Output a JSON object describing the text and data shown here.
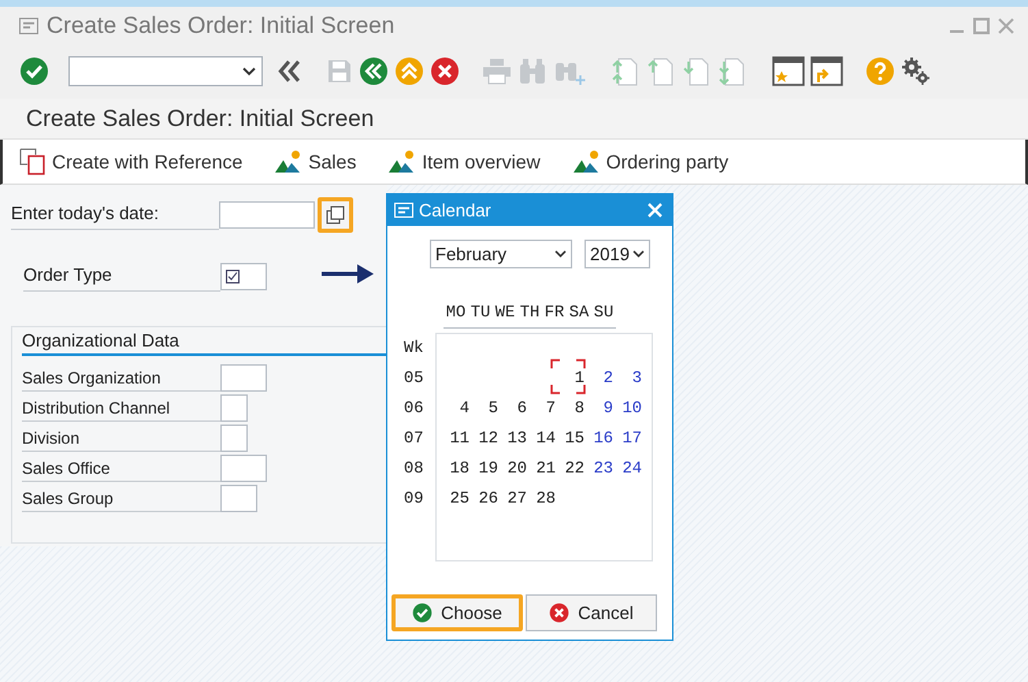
{
  "window": {
    "title": "Create Sales Order: Initial Screen"
  },
  "toolbar": [
    {
      "kind": "enter",
      "disabled": false
    },
    {
      "kind": "command_field",
      "disabled": false
    },
    {
      "kind": "back_arrows",
      "disabled": false
    },
    {
      "kind": "save",
      "disabled": true
    },
    {
      "kind": "back",
      "disabled": false
    },
    {
      "kind": "exit",
      "disabled": false
    },
    {
      "kind": "cancel",
      "disabled": false
    },
    {
      "kind": "print",
      "disabled": true
    },
    {
      "kind": "find",
      "disabled": true
    },
    {
      "kind": "find_next",
      "disabled": true
    },
    {
      "kind": "first_page",
      "disabled": true
    },
    {
      "kind": "prev_page",
      "disabled": true
    },
    {
      "kind": "next_page",
      "disabled": true
    },
    {
      "kind": "last_page",
      "disabled": true
    },
    {
      "kind": "new_session",
      "disabled": false
    },
    {
      "kind": "shortcut",
      "disabled": false
    },
    {
      "kind": "help",
      "disabled": false
    },
    {
      "kind": "settings",
      "disabled": false
    }
  ],
  "screen_title": "Create Sales Order: Initial Screen",
  "actions": [
    {
      "kind": "reference",
      "label": "Create with Reference"
    },
    {
      "kind": "overview",
      "label": "Sales"
    },
    {
      "kind": "overview",
      "label": "Item overview"
    },
    {
      "kind": "overview",
      "label": "Ordering party"
    }
  ],
  "date_field": {
    "label": "Enter today's date:",
    "button_highlighted": true
  },
  "order_type": {
    "label": "Order Type"
  },
  "org_data": {
    "title": "Organizational Data",
    "fields": [
      {
        "label": "Sales Organization"
      },
      {
        "label": "Distribution Channel"
      },
      {
        "label": "Division"
      },
      {
        "label": "Sales Office"
      },
      {
        "label": "Sales Group"
      }
    ]
  },
  "calendar": {
    "title": "Calendar",
    "month": "February",
    "year": "2019",
    "weekdays": [
      "MO",
      "TU",
      "WE",
      "TH",
      "FR",
      "SA",
      "SU"
    ],
    "week_header": "Wk",
    "weeks": [
      {
        "week": "05",
        "kind": "partial_start",
        "days": [
          {
            "label": "1",
            "weekend": false,
            "selected": true
          },
          {
            "label": "2",
            "weekend": true,
            "selected": false
          },
          {
            "label": "3",
            "weekend": true,
            "selected": false
          }
        ]
      },
      {
        "week": "06",
        "kind": "full",
        "days": [
          {
            "label": "4",
            "weekend": false,
            "selected": false
          },
          {
            "label": "5",
            "weekend": false,
            "selected": false
          },
          {
            "label": "6",
            "weekend": false,
            "selected": false
          },
          {
            "label": "7",
            "weekend": false,
            "selected": false
          },
          {
            "label": "8",
            "weekend": false,
            "selected": false
          },
          {
            "label": "9",
            "weekend": true,
            "selected": false
          },
          {
            "label": "10",
            "weekend": true,
            "selected": false
          }
        ]
      },
      {
        "week": "07",
        "kind": "full",
        "days": [
          {
            "label": "11",
            "weekend": false,
            "selected": false
          },
          {
            "label": "12",
            "weekend": false,
            "selected": false
          },
          {
            "label": "13",
            "weekend": false,
            "selected": false
          },
          {
            "label": "14",
            "weekend": false,
            "selected": false
          },
          {
            "label": "15",
            "weekend": false,
            "selected": false
          },
          {
            "label": "16",
            "weekend": true,
            "selected": false
          },
          {
            "label": "17",
            "weekend": true,
            "selected": false
          }
        ]
      },
      {
        "week": "08",
        "kind": "full",
        "days": [
          {
            "label": "18",
            "weekend": false,
            "selected": false
          },
          {
            "label": "19",
            "weekend": false,
            "selected": false
          },
          {
            "label": "20",
            "weekend": false,
            "selected": false
          },
          {
            "label": "21",
            "weekend": false,
            "selected": false
          },
          {
            "label": "22",
            "weekend": false,
            "selected": false
          },
          {
            "label": "23",
            "weekend": true,
            "selected": false
          },
          {
            "label": "24",
            "weekend": true,
            "selected": false
          }
        ]
      },
      {
        "week": "09",
        "kind": "partial_end",
        "days": [
          {
            "label": "25",
            "weekend": false,
            "selected": false
          },
          {
            "label": "26",
            "weekend": false,
            "selected": false
          },
          {
            "label": "27",
            "weekend": false,
            "selected": false
          },
          {
            "label": "28",
            "weekend": false,
            "selected": false
          }
        ]
      }
    ],
    "buttons": [
      {
        "kind": "choose",
        "label": "Choose",
        "highlighted": true
      },
      {
        "kind": "cancel",
        "label": "Cancel",
        "highlighted": false
      }
    ]
  }
}
